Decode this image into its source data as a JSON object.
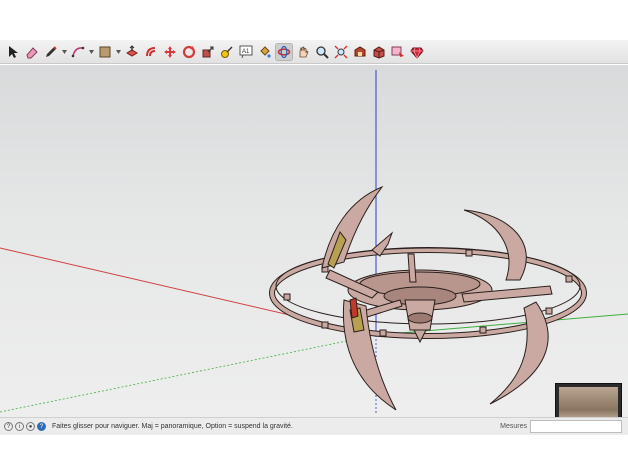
{
  "toolbar": {
    "tools": [
      {
        "name": "select-tool-icon",
        "active": false
      },
      {
        "name": "eraser-tool-icon",
        "active": false
      },
      {
        "name": "pencil-tool-icon",
        "active": false
      },
      {
        "name": "arc-tool-icon",
        "active": false
      },
      {
        "name": "rectangle-tool-icon",
        "active": false
      },
      {
        "name": "push-pull-tool-icon",
        "active": false
      },
      {
        "name": "offset-tool-icon",
        "active": false
      },
      {
        "name": "move-tool-icon",
        "active": false
      },
      {
        "name": "rotate-tool-icon",
        "active": false
      },
      {
        "name": "scale-tool-icon",
        "active": false
      },
      {
        "name": "tape-measure-tool-icon",
        "active": false
      },
      {
        "name": "text-tool-icon",
        "active": false
      },
      {
        "name": "paint-bucket-tool-icon",
        "active": false
      },
      {
        "name": "orbit-tool-icon",
        "active": true
      },
      {
        "name": "pan-tool-icon",
        "active": false
      },
      {
        "name": "zoom-tool-icon",
        "active": false
      },
      {
        "name": "zoom-extents-tool-icon",
        "active": false
      },
      {
        "name": "warehouse-icon",
        "active": false
      },
      {
        "name": "extension-warehouse-icon",
        "active": false
      },
      {
        "name": "send-to-layout-icon",
        "active": false
      },
      {
        "name": "ruby-console-icon",
        "active": false
      }
    ],
    "text_tool_glyph": "A1"
  },
  "status": {
    "message": "Faites glisser pour naviguer. Maj = panoramique, Option =  suspend la gravité.",
    "mesures_label": "Mesures",
    "mesures_value": ""
  },
  "colors": {
    "axis_red": "#d04040",
    "axis_green": "#3fae3f",
    "axis_blue": "#2b3fcf",
    "model_fill": "#c9a9a1",
    "model_stroke": "#2a1f1c",
    "active_tool": "#cfcfcf"
  }
}
